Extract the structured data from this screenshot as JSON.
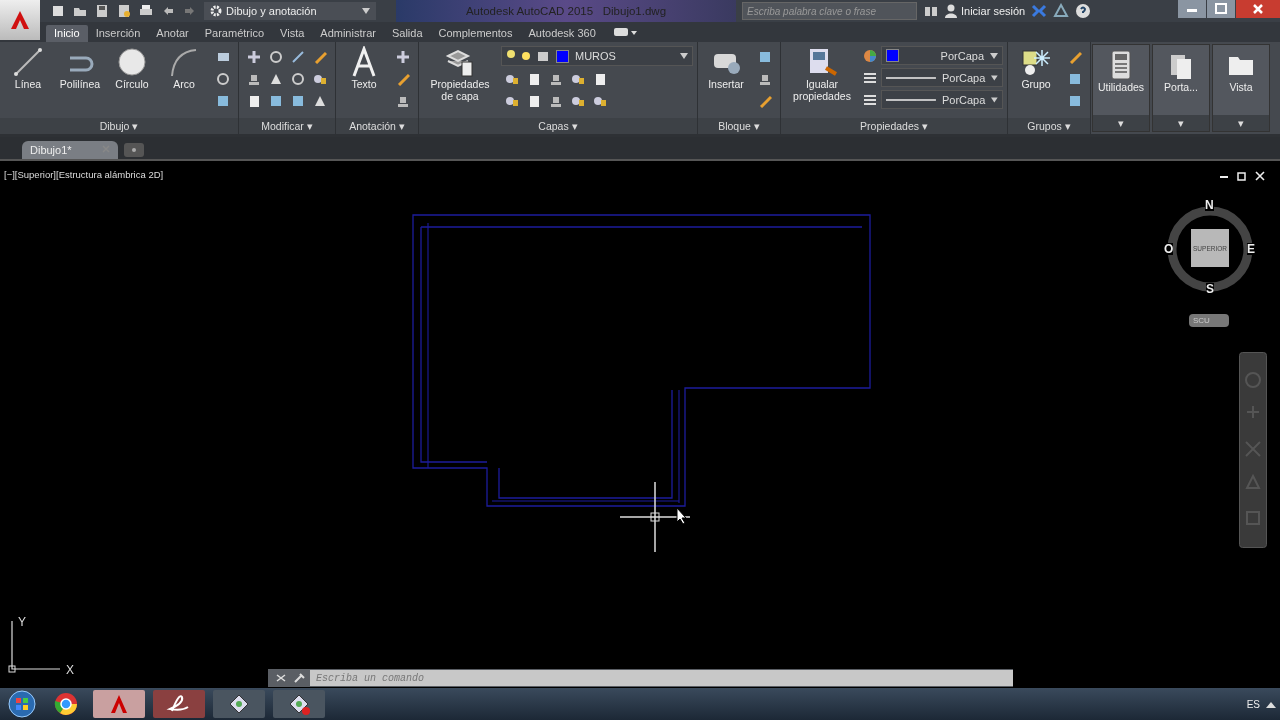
{
  "title_bar": {
    "workspace": "Dibujo y anotación",
    "title": "Autodesk AutoCAD 2015   Dibujo1.dwg",
    "search": {
      "placeholder": "Escriba palabra clave o frase"
    },
    "sign_in": "Iniciar sesión"
  },
  "ribbon_tabs": [
    {
      "label": "Inicio",
      "selected": true
    },
    {
      "label": "Inserción",
      "selected": false
    },
    {
      "label": "Anotar",
      "selected": false
    },
    {
      "label": "Paramétrico",
      "selected": false
    },
    {
      "label": "Vista",
      "selected": false
    },
    {
      "label": "Administrar",
      "selected": false
    },
    {
      "label": "Salida",
      "selected": false
    },
    {
      "label": "Complementos",
      "selected": false
    },
    {
      "label": "Autodesk 360",
      "selected": false
    }
  ],
  "panels": [
    {
      "kind": "dibujo",
      "title": "Dibujo ▾",
      "tools": [
        {
          "label": "Línea"
        },
        {
          "label": "Polilínea"
        },
        {
          "label": "Círculo"
        },
        {
          "label": "Arco"
        }
      ]
    },
    {
      "kind": "modificar",
      "title": "Modificar ▾"
    },
    {
      "kind": "anotacion",
      "title": "Anotación ▾",
      "tools": [
        {
          "label": "Texto"
        }
      ]
    },
    {
      "kind": "capas",
      "title": "Capas ▾",
      "tools": [
        {
          "label": "Propiedades de capa"
        }
      ],
      "layer": {
        "name": "MUROS",
        "color": "#0000ff"
      }
    },
    {
      "kind": "bloque",
      "title": "Bloque ▾",
      "tools": [
        {
          "label": "Insertar"
        }
      ]
    },
    {
      "kind": "propiedades",
      "title": "Propiedades ▾",
      "tools": [
        {
          "label": "Igualar propiedades"
        }
      ],
      "properties": [
        {
          "kind": "color",
          "value": "PorCapa",
          "color": "#0000ff"
        },
        {
          "kind": "line",
          "value": "PorCapa"
        },
        {
          "kind": "line",
          "value": "PorCapa"
        }
      ]
    },
    {
      "kind": "grupos",
      "title": "Grupos ▾",
      "tools": [
        {
          "label": "Grupo"
        }
      ]
    },
    {
      "kind": "utilidades",
      "title": "▾",
      "tools": [
        {
          "label": "Utilidades"
        }
      ]
    },
    {
      "kind": "portapapeles",
      "title": "▾",
      "tools": [
        {
          "label": "Porta..."
        }
      ]
    },
    {
      "kind": "vista",
      "title": "▾",
      "tools": [
        {
          "label": "Vista"
        }
      ]
    }
  ],
  "document_tabs": [
    {
      "label": "Dibujo1*",
      "selected": true
    }
  ],
  "viewport": {
    "label": "[−][Superior][Estructura alámbrica 2D]",
    "viewcube": {
      "north": "N",
      "south": "S",
      "east": "E",
      "west": "O",
      "face": "SUPERIOR",
      "ucs": "SCU"
    },
    "ucs_icon": {
      "x": "X",
      "y": "Y"
    }
  },
  "command_line": {
    "placeholder": "Escriba un comando"
  },
  "taskbar": {
    "language": "ES"
  }
}
